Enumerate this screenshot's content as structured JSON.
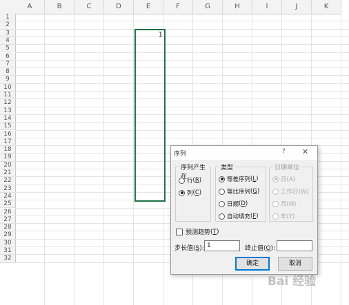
{
  "sheet": {
    "columns": [
      "A",
      "B",
      "C",
      "D",
      "E",
      "F",
      "G",
      "H",
      "I",
      "J",
      "K"
    ],
    "rows": [
      "1",
      "2",
      "3",
      "4",
      "5",
      "6",
      "7",
      "8",
      "9",
      "10",
      "11",
      "12",
      "13",
      "14",
      "15",
      "16",
      "17",
      "18",
      "19",
      "20",
      "21",
      "22",
      "23",
      "24",
      "25",
      "26",
      "27",
      "28",
      "29",
      "30",
      "31",
      "32"
    ],
    "cell_e3": "1",
    "accent": "#217346"
  },
  "dialog": {
    "title": "序列",
    "help": "?",
    "close": "✕",
    "series_in_label": "序列产生在",
    "series_in": [
      {
        "label": "行",
        "key": "R",
        "checked": false
      },
      {
        "label": "列",
        "key": "C",
        "checked": true
      }
    ],
    "type_label": "类型",
    "types": [
      {
        "label": "等差序列",
        "key": "L",
        "checked": true
      },
      {
        "label": "等比序列",
        "key": "G",
        "checked": false
      },
      {
        "label": "日期",
        "key": "D",
        "checked": false
      },
      {
        "label": "自动填充",
        "key": "F",
        "checked": false
      }
    ],
    "date_unit_label": "日期单位",
    "date_units": [
      {
        "label": "日(A)",
        "checked": true
      },
      {
        "label": "工作日(W)",
        "checked": false
      },
      {
        "label": "月(M)",
        "checked": false
      },
      {
        "label": "年(Y)",
        "checked": false
      }
    ],
    "trend": {
      "label": "预测趋势",
      "key": "T",
      "checked": false
    },
    "step": {
      "label": "步长值",
      "key": "S",
      "value": "1"
    },
    "stop": {
      "label": "终止值",
      "key": "O",
      "value": ""
    },
    "ok_label": "确定",
    "cancel_label": "取消",
    "accent": "#0078d7"
  },
  "watermark": "Bai 经验"
}
